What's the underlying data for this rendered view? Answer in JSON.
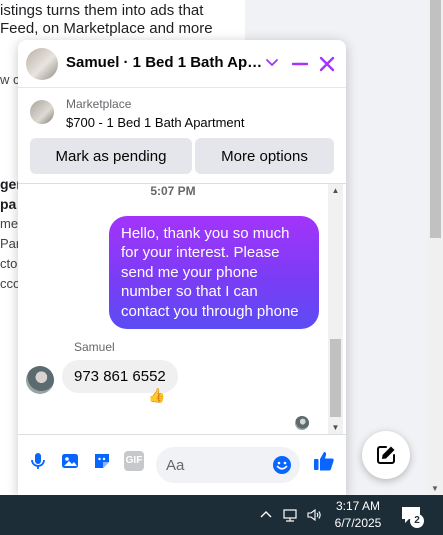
{
  "background_page": {
    "lines": [
      "istings turns them into ads that",
      "Feed, on Marketplace and more",
      "w c",
      "gen",
      "pa",
      "mer",
      "Par",
      "cto",
      "cco"
    ]
  },
  "chat": {
    "title": "Samuel · 1 Bed 1 Bath Apar...",
    "icons": {
      "chevron": "chevron-down-icon",
      "minimize": "minimize-icon",
      "close": "close-icon"
    },
    "listing": {
      "source": "Marketplace",
      "title": "$700 - 1 Bed 1 Bath Apartment"
    },
    "buttons": {
      "mark_pending": "Mark as pending",
      "more_options": "More options"
    },
    "timestamp": "5:07 PM",
    "outgoing_message": "Hello, thank you so much for your interest. Please send me your phone number so that I can contact you through phone",
    "sender_name": "Samuel",
    "incoming_message": "973 861 6552",
    "reaction": "👍",
    "composer": {
      "placeholder": "Aa",
      "gif_label": "GIF"
    }
  },
  "colors": {
    "accent": "#a334fa",
    "messenger_blue": "#0866ff",
    "bubble_gradient_end": "#5b4cf4",
    "taskbar": "#1c2d38"
  },
  "taskbar": {
    "time": "3:17 AM",
    "date": "6/7/2025",
    "notification_count": "2"
  }
}
